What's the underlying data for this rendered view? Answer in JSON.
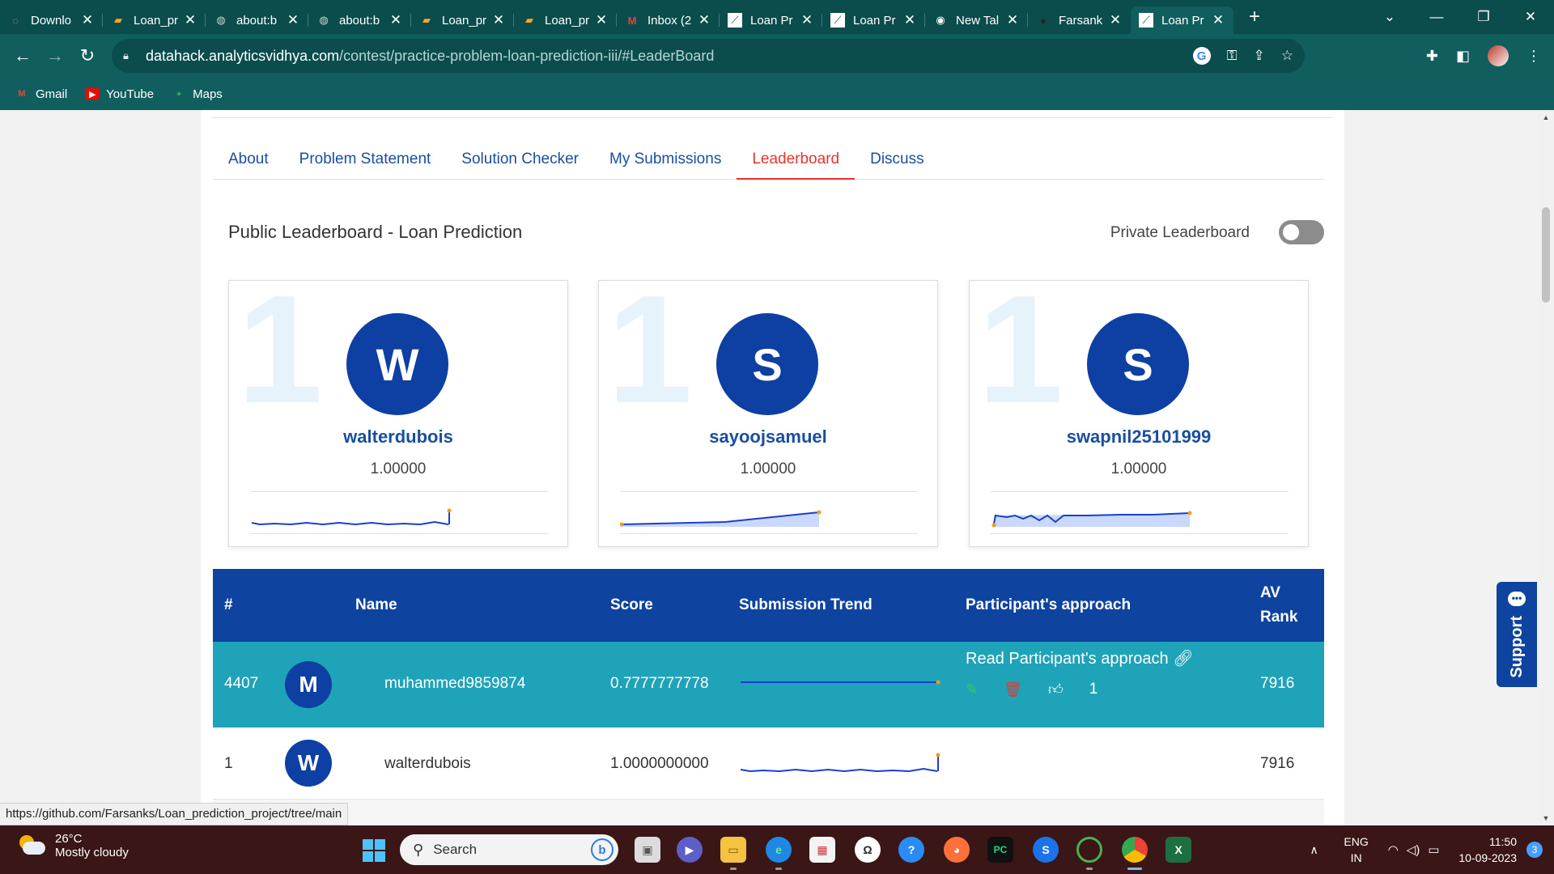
{
  "browser": {
    "tabs": [
      {
        "title": "Downlo",
        "active": false
      },
      {
        "title": "Loan_pr",
        "active": false
      },
      {
        "title": "about:b",
        "active": false
      },
      {
        "title": "about:b",
        "active": false
      },
      {
        "title": "Loan_pr",
        "active": false
      },
      {
        "title": "Loan_pr",
        "active": false
      },
      {
        "title": "Inbox (2",
        "active": false
      },
      {
        "title": "Loan Pr",
        "active": false
      },
      {
        "title": "Loan Pr",
        "active": false
      },
      {
        "title": "New Tal",
        "active": false
      },
      {
        "title": "Farsank",
        "active": false
      },
      {
        "title": "Loan Pr",
        "active": true
      }
    ],
    "url_host": "datahack.analyticsvidhya.com",
    "url_path": "/contest/practice-problem-loan-prediction-iii/#LeaderBoard",
    "bookmarks": [
      {
        "label": "Gmail",
        "icon": "gmail-icon"
      },
      {
        "label": "YouTube",
        "icon": "youtube-icon"
      },
      {
        "label": "Maps",
        "icon": "maps-icon"
      }
    ]
  },
  "page": {
    "tabs": [
      "About",
      "Problem Statement",
      "Solution Checker",
      "My Submissions",
      "Leaderboard",
      "Discuss"
    ],
    "active_tab": "Leaderboard",
    "leaderboard_title": "Public Leaderboard - Loan Prediction",
    "private_label": "Private Leaderboard",
    "private_toggle_on": false,
    "top_cards": [
      {
        "rank": "1",
        "initial": "W",
        "name": "walterdubois",
        "score": "1.00000"
      },
      {
        "rank": "1",
        "initial": "S",
        "name": "sayoojsamuel",
        "score": "1.00000"
      },
      {
        "rank": "1",
        "initial": "S",
        "name": "swapnil25101999",
        "score": "1.00000"
      }
    ],
    "table": {
      "headers": {
        "rank": "#",
        "name": "Name",
        "score": "Score",
        "trend": "Submission Trend",
        "approach": "Participant's approach",
        "av_rank_1": "AV",
        "av_rank_2": "Rank"
      },
      "rows": [
        {
          "rank": "4407",
          "initial": "M",
          "name": "muhammed9859874",
          "score": "0.7777777778",
          "approach_link": "Read Participant's approach",
          "likes": "1",
          "av_rank": "7916",
          "highlighted": true
        },
        {
          "rank": "1",
          "initial": "W",
          "name": "walterdubois",
          "score": "1.0000000000",
          "approach_link": "",
          "likes": "",
          "av_rank": "7916",
          "highlighted": false
        }
      ]
    },
    "support_label": "Support",
    "status_url": "https://github.com/Farsanks/Loan_prediction_project/tree/main"
  },
  "taskbar": {
    "temperature": "26°C",
    "weather": "Mostly cloudy",
    "search_placeholder": "Search",
    "lang_1": "ENG",
    "lang_2": "IN",
    "time": "11:50",
    "date": "10-09-2023",
    "notifications": "3"
  },
  "colors": {
    "chrome": "#115e5e",
    "header_blue": "#0e44a0",
    "highlight_row": "#1fa3b8",
    "active_tab": "#e5342b"
  }
}
